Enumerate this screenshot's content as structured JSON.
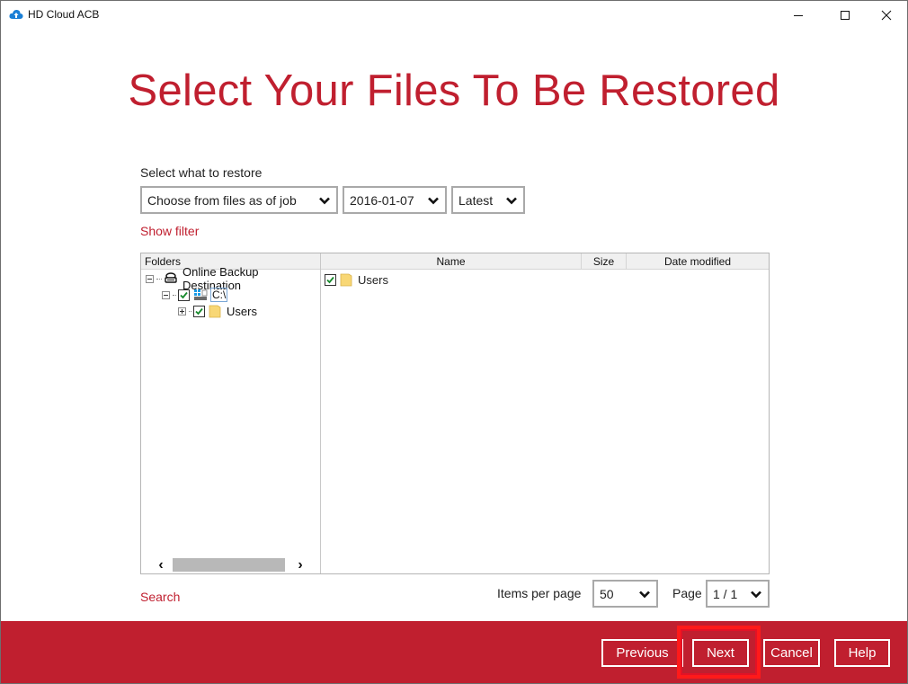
{
  "window": {
    "app_title": "HD Cloud ACB",
    "accent_color": "#c01f2f",
    "icons": {
      "app": "cloud-icon",
      "minimize": "minimize-icon",
      "maximize": "maximize-icon",
      "close": "close-icon"
    }
  },
  "page": {
    "title": "Select Your Files To Be Restored",
    "restore_label": "Select what to restore",
    "restore_mode": {
      "selected": "Choose from files as of job"
    },
    "date": {
      "selected": "2016-01-07"
    },
    "version": {
      "selected": "Latest"
    },
    "show_filter": "Show filter",
    "search": "Search"
  },
  "folders": {
    "header": "Folders",
    "tree": [
      {
        "label": "Online Backup Destination",
        "icon": "backup-destination-icon",
        "expanded": true
      },
      {
        "label": "C:\\",
        "icon": "drive-icon",
        "checked": true,
        "expanded": true
      },
      {
        "label": "Users",
        "icon": "folder-icon",
        "checked": true,
        "expanded": false
      }
    ]
  },
  "files": {
    "columns": [
      "Name",
      "Size",
      "Date modified"
    ],
    "rows": [
      {
        "name": "Users",
        "size": "",
        "date_modified": "",
        "checked": true
      }
    ]
  },
  "pagination": {
    "items_per_page_label": "Items per page",
    "items_per_page": "50",
    "page_label": "Page",
    "page": "1 / 1"
  },
  "footer": {
    "previous": "Previous",
    "next": "Next",
    "cancel": "Cancel",
    "help": "Help",
    "highlighted": "Next",
    "highlight_color": "#ff1a1a"
  }
}
